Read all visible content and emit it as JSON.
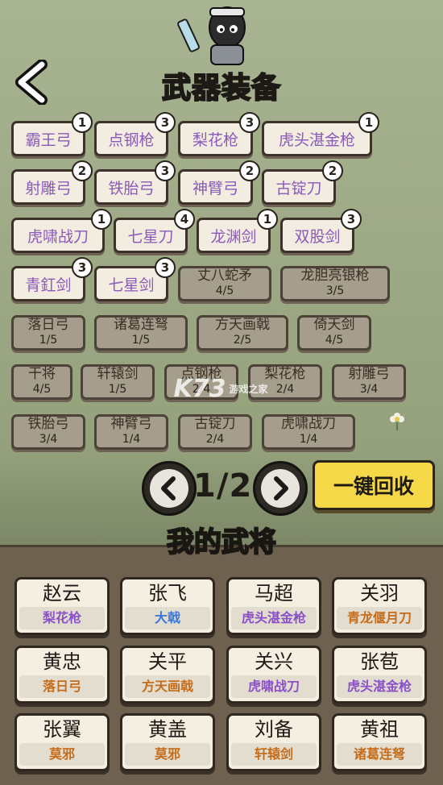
{
  "header": {
    "title": "武器装备"
  },
  "weapons": {
    "owned": [
      {
        "name": "霸王弓",
        "count": "1"
      },
      {
        "name": "点钢枪",
        "count": "3"
      },
      {
        "name": "梨花枪",
        "count": "3"
      },
      {
        "name": "虎头湛金枪",
        "count": "1"
      },
      {
        "name": "射雕弓",
        "count": "2"
      },
      {
        "name": "铁胎弓",
        "count": "3"
      },
      {
        "name": "神臂弓",
        "count": "2"
      },
      {
        "name": "古锭刀",
        "count": "2"
      },
      {
        "name": "虎啸战刀",
        "count": "1"
      },
      {
        "name": "七星刀",
        "count": "4"
      },
      {
        "name": "龙渊剑",
        "count": "1"
      },
      {
        "name": "双股剑",
        "count": "3"
      },
      {
        "name": "青釭剑",
        "count": "3"
      },
      {
        "name": "七星剑",
        "count": "3"
      }
    ],
    "locked": [
      {
        "name": "丈八蛇矛",
        "progress": "4/5"
      },
      {
        "name": "龙胆亮银枪",
        "progress": "3/5"
      },
      {
        "name": "落日弓",
        "progress": "1/5"
      },
      {
        "name": "诸葛连弩",
        "progress": "1/5"
      },
      {
        "name": "方天画戟",
        "progress": "2/5"
      },
      {
        "name": "倚天剑",
        "progress": "4/5"
      },
      {
        "name": "干将",
        "progress": "4/5"
      },
      {
        "name": "轩辕剑",
        "progress": "1/5"
      },
      {
        "name": "点钢枪",
        "progress": "2/4"
      },
      {
        "name": "梨花枪",
        "progress": "2/4"
      },
      {
        "name": "射雕弓",
        "progress": "3/4"
      },
      {
        "name": "铁胎弓",
        "progress": "3/4"
      },
      {
        "name": "神臂弓",
        "progress": "1/4"
      },
      {
        "name": "古锭刀",
        "progress": "2/4"
      },
      {
        "name": "虎啸战刀",
        "progress": "1/4"
      }
    ]
  },
  "pager": {
    "indicator": "1/2"
  },
  "actions": {
    "recycle_label": "一键回收"
  },
  "generals_section": {
    "title": "我的武将",
    "generals": [
      {
        "name": "赵云",
        "weapon": "梨花枪"
      },
      {
        "name": "张飞",
        "weapon": "大戟"
      },
      {
        "name": "马超",
        "weapon": "虎头湛金枪"
      },
      {
        "name": "关羽",
        "weapon": "青龙偃月刀"
      },
      {
        "name": "黄忠",
        "weapon": "落日弓"
      },
      {
        "name": "关平",
        "weapon": "方天画戟"
      },
      {
        "name": "关兴",
        "weapon": "虎啸战刀"
      },
      {
        "name": "张苞",
        "weapon": "虎头湛金枪"
      },
      {
        "name": "张翼",
        "weapon": "莫邪"
      },
      {
        "name": "黄盖",
        "weapon": "莫邪"
      },
      {
        "name": "刘备",
        "weapon": "轩辕剑"
      },
      {
        "name": "黄祖",
        "weapon": "诸葛连弩"
      }
    ]
  },
  "watermark": {
    "logo": "K73",
    "subtext": "游戏之家"
  },
  "colors": {
    "title_gold": "#f2c43a",
    "weapon_purple": "#8a5ab8",
    "weapon_blue": "#3a76d8",
    "weapon_orange": "#c56c1a",
    "recycle_yellow": "#f4d848"
  },
  "icons": [
    "back-arrow-icon",
    "prev-page-icon",
    "next-page-icon",
    "mascot-icon",
    "flower-icon"
  ]
}
